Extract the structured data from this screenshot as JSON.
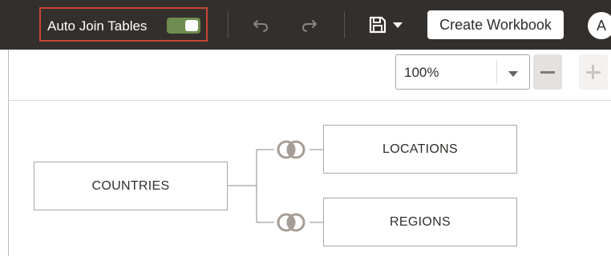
{
  "toolbar": {
    "auto_join_label": "Auto Join Tables",
    "auto_join_on": true,
    "create_workbook_label": "Create Workbook",
    "avatar_initial": "A",
    "icons": [
      "undo-icon",
      "redo-icon",
      "save-icon",
      "chevron-down-icon"
    ]
  },
  "zoom": {
    "value": "100%",
    "minus_icon": "minus-icon",
    "plus_icon": "plus-icon"
  },
  "diagram": {
    "tables": [
      "COUNTRIES",
      "LOCATIONS",
      "REGIONS"
    ],
    "joins": [
      {
        "from": "COUNTRIES",
        "to": "LOCATIONS",
        "icon": "join-icon"
      },
      {
        "from": "COUNTRIES",
        "to": "REGIONS",
        "icon": "join-icon"
      }
    ]
  },
  "colors": {
    "toolbar_bg": "#332f2c",
    "highlight": "#c74634",
    "toggle_on": "#6f8b4f",
    "join_icon": "#a59d95"
  }
}
